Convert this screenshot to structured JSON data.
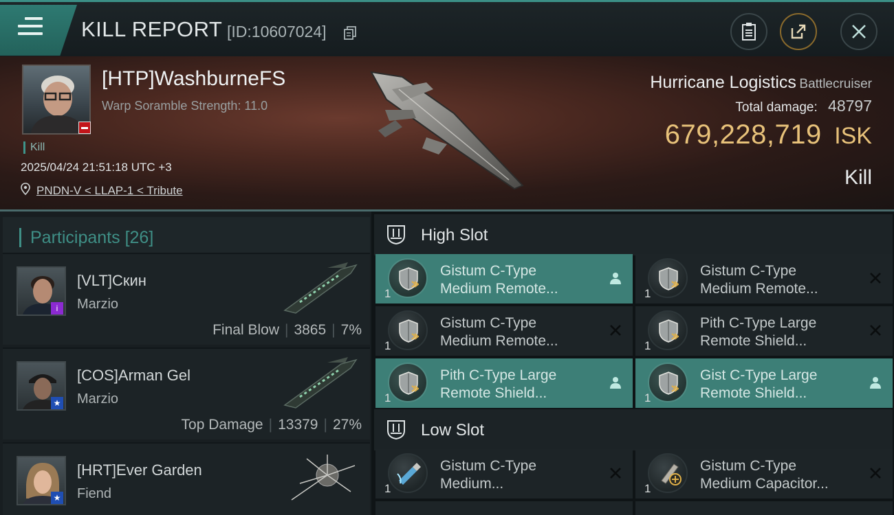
{
  "header": {
    "title": "KILL REPORT",
    "kill_id": "[ID:10607024]"
  },
  "victim": {
    "name": "[HTP]WashburneFS",
    "scramble": "Warp Soramble Strength: 11.0",
    "kill_tag": "Kill",
    "timestamp": "2025/04/24 21:51:18 UTC +3",
    "location": "PNDN-V < LLAP-1 < Tribute"
  },
  "ship": {
    "name": "Hurricane Logistics",
    "class": "Battlecruiser",
    "total_damage_label": "Total damage:",
    "total_damage": "48797",
    "isk_value": "679,228,719",
    "isk_currency": "ISK",
    "result": "Kill"
  },
  "participants": {
    "label": "Participants",
    "count": "[26]",
    "rows": [
      {
        "name": "[VLT]Скин",
        "ship": "Marzio",
        "stat_label": "Final Blow",
        "damage": "3865",
        "percent": "7%"
      },
      {
        "name": "[COS]Arman Gel",
        "ship": "Marzio",
        "stat_label": "Top Damage",
        "damage": "13379",
        "percent": "27%"
      },
      {
        "name": "[HRT]Ever Garden",
        "ship": "Fiend"
      }
    ]
  },
  "slots": {
    "high": {
      "title": "High Slot",
      "modules": [
        {
          "qty": "1",
          "line1": "Gistum C-Type",
          "line2": "Medium Remote...",
          "state": "person"
        },
        {
          "qty": "1",
          "line1": "Gistum C-Type",
          "line2": "Medium Remote...",
          "state": "x"
        },
        {
          "qty": "1",
          "line1": "Gistum C-Type",
          "line2": "Medium Remote...",
          "state": "x"
        },
        {
          "qty": "1",
          "line1": "Pith C-Type Large",
          "line2": "Remote Shield...",
          "state": "x"
        },
        {
          "qty": "1",
          "line1": "Pith C-Type Large",
          "line2": "Remote Shield...",
          "state": "person"
        },
        {
          "qty": "1",
          "line1": "Gist C-Type Large",
          "line2": "Remote Shield...",
          "state": "person"
        }
      ]
    },
    "low": {
      "title": "Low Slot",
      "modules": [
        {
          "qty": "1",
          "line1": "Gistum C-Type",
          "line2": "Medium...",
          "state": "x"
        },
        {
          "qty": "1",
          "line1": "Gistum C-Type",
          "line2": "Medium Capacitor...",
          "state": "x"
        }
      ]
    }
  },
  "colors": {
    "accent": "#3e948a",
    "highlight_row": "#3d7f77",
    "isk_gold": "#e8c27a",
    "security_red": "#c2151a"
  },
  "icons": [
    "menu-icon",
    "copy-icon",
    "clipboard-icon",
    "share-icon",
    "close-icon",
    "location-pin-icon",
    "shield-module-icon",
    "high-slot-icon",
    "low-slot-icon",
    "person-icon",
    "x-icon"
  ]
}
